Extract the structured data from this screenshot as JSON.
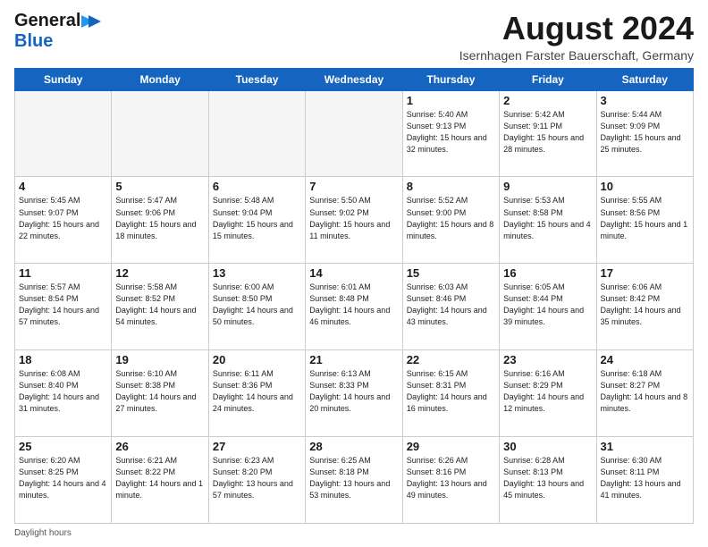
{
  "header": {
    "logo_line1": "General",
    "logo_line2": "Blue",
    "month_title": "August 2024",
    "subtitle": "Isernhagen Farster Bauerschaft, Germany"
  },
  "days_of_week": [
    "Sunday",
    "Monday",
    "Tuesday",
    "Wednesday",
    "Thursday",
    "Friday",
    "Saturday"
  ],
  "weeks": [
    [
      {
        "day": "",
        "sunrise": "",
        "sunset": "",
        "daylight": "",
        "empty": true
      },
      {
        "day": "",
        "sunrise": "",
        "sunset": "",
        "daylight": "",
        "empty": true
      },
      {
        "day": "",
        "sunrise": "",
        "sunset": "",
        "daylight": "",
        "empty": true
      },
      {
        "day": "",
        "sunrise": "",
        "sunset": "",
        "daylight": "",
        "empty": true
      },
      {
        "day": "1",
        "sunrise": "Sunrise: 5:40 AM",
        "sunset": "Sunset: 9:13 PM",
        "daylight": "Daylight: 15 hours and 32 minutes."
      },
      {
        "day": "2",
        "sunrise": "Sunrise: 5:42 AM",
        "sunset": "Sunset: 9:11 PM",
        "daylight": "Daylight: 15 hours and 28 minutes."
      },
      {
        "day": "3",
        "sunrise": "Sunrise: 5:44 AM",
        "sunset": "Sunset: 9:09 PM",
        "daylight": "Daylight: 15 hours and 25 minutes."
      }
    ],
    [
      {
        "day": "4",
        "sunrise": "Sunrise: 5:45 AM",
        "sunset": "Sunset: 9:07 PM",
        "daylight": "Daylight: 15 hours and 22 minutes."
      },
      {
        "day": "5",
        "sunrise": "Sunrise: 5:47 AM",
        "sunset": "Sunset: 9:06 PM",
        "daylight": "Daylight: 15 hours and 18 minutes."
      },
      {
        "day": "6",
        "sunrise": "Sunrise: 5:48 AM",
        "sunset": "Sunset: 9:04 PM",
        "daylight": "Daylight: 15 hours and 15 minutes."
      },
      {
        "day": "7",
        "sunrise": "Sunrise: 5:50 AM",
        "sunset": "Sunset: 9:02 PM",
        "daylight": "Daylight: 15 hours and 11 minutes."
      },
      {
        "day": "8",
        "sunrise": "Sunrise: 5:52 AM",
        "sunset": "Sunset: 9:00 PM",
        "daylight": "Daylight: 15 hours and 8 minutes."
      },
      {
        "day": "9",
        "sunrise": "Sunrise: 5:53 AM",
        "sunset": "Sunset: 8:58 PM",
        "daylight": "Daylight: 15 hours and 4 minutes."
      },
      {
        "day": "10",
        "sunrise": "Sunrise: 5:55 AM",
        "sunset": "Sunset: 8:56 PM",
        "daylight": "Daylight: 15 hours and 1 minute."
      }
    ],
    [
      {
        "day": "11",
        "sunrise": "Sunrise: 5:57 AM",
        "sunset": "Sunset: 8:54 PM",
        "daylight": "Daylight: 14 hours and 57 minutes."
      },
      {
        "day": "12",
        "sunrise": "Sunrise: 5:58 AM",
        "sunset": "Sunset: 8:52 PM",
        "daylight": "Daylight: 14 hours and 54 minutes."
      },
      {
        "day": "13",
        "sunrise": "Sunrise: 6:00 AM",
        "sunset": "Sunset: 8:50 PM",
        "daylight": "Daylight: 14 hours and 50 minutes."
      },
      {
        "day": "14",
        "sunrise": "Sunrise: 6:01 AM",
        "sunset": "Sunset: 8:48 PM",
        "daylight": "Daylight: 14 hours and 46 minutes."
      },
      {
        "day": "15",
        "sunrise": "Sunrise: 6:03 AM",
        "sunset": "Sunset: 8:46 PM",
        "daylight": "Daylight: 14 hours and 43 minutes."
      },
      {
        "day": "16",
        "sunrise": "Sunrise: 6:05 AM",
        "sunset": "Sunset: 8:44 PM",
        "daylight": "Daylight: 14 hours and 39 minutes."
      },
      {
        "day": "17",
        "sunrise": "Sunrise: 6:06 AM",
        "sunset": "Sunset: 8:42 PM",
        "daylight": "Daylight: 14 hours and 35 minutes."
      }
    ],
    [
      {
        "day": "18",
        "sunrise": "Sunrise: 6:08 AM",
        "sunset": "Sunset: 8:40 PM",
        "daylight": "Daylight: 14 hours and 31 minutes."
      },
      {
        "day": "19",
        "sunrise": "Sunrise: 6:10 AM",
        "sunset": "Sunset: 8:38 PM",
        "daylight": "Daylight: 14 hours and 27 minutes."
      },
      {
        "day": "20",
        "sunrise": "Sunrise: 6:11 AM",
        "sunset": "Sunset: 8:36 PM",
        "daylight": "Daylight: 14 hours and 24 minutes."
      },
      {
        "day": "21",
        "sunrise": "Sunrise: 6:13 AM",
        "sunset": "Sunset: 8:33 PM",
        "daylight": "Daylight: 14 hours and 20 minutes."
      },
      {
        "day": "22",
        "sunrise": "Sunrise: 6:15 AM",
        "sunset": "Sunset: 8:31 PM",
        "daylight": "Daylight: 14 hours and 16 minutes."
      },
      {
        "day": "23",
        "sunrise": "Sunrise: 6:16 AM",
        "sunset": "Sunset: 8:29 PM",
        "daylight": "Daylight: 14 hours and 12 minutes."
      },
      {
        "day": "24",
        "sunrise": "Sunrise: 6:18 AM",
        "sunset": "Sunset: 8:27 PM",
        "daylight": "Daylight: 14 hours and 8 minutes."
      }
    ],
    [
      {
        "day": "25",
        "sunrise": "Sunrise: 6:20 AM",
        "sunset": "Sunset: 8:25 PM",
        "daylight": "Daylight: 14 hours and 4 minutes."
      },
      {
        "day": "26",
        "sunrise": "Sunrise: 6:21 AM",
        "sunset": "Sunset: 8:22 PM",
        "daylight": "Daylight: 14 hours and 1 minute."
      },
      {
        "day": "27",
        "sunrise": "Sunrise: 6:23 AM",
        "sunset": "Sunset: 8:20 PM",
        "daylight": "Daylight: 13 hours and 57 minutes."
      },
      {
        "day": "28",
        "sunrise": "Sunrise: 6:25 AM",
        "sunset": "Sunset: 8:18 PM",
        "daylight": "Daylight: 13 hours and 53 minutes."
      },
      {
        "day": "29",
        "sunrise": "Sunrise: 6:26 AM",
        "sunset": "Sunset: 8:16 PM",
        "daylight": "Daylight: 13 hours and 49 minutes."
      },
      {
        "day": "30",
        "sunrise": "Sunrise: 6:28 AM",
        "sunset": "Sunset: 8:13 PM",
        "daylight": "Daylight: 13 hours and 45 minutes."
      },
      {
        "day": "31",
        "sunrise": "Sunrise: 6:30 AM",
        "sunset": "Sunset: 8:11 PM",
        "daylight": "Daylight: 13 hours and 41 minutes."
      }
    ]
  ],
  "footer": {
    "daylight_label": "Daylight hours"
  }
}
